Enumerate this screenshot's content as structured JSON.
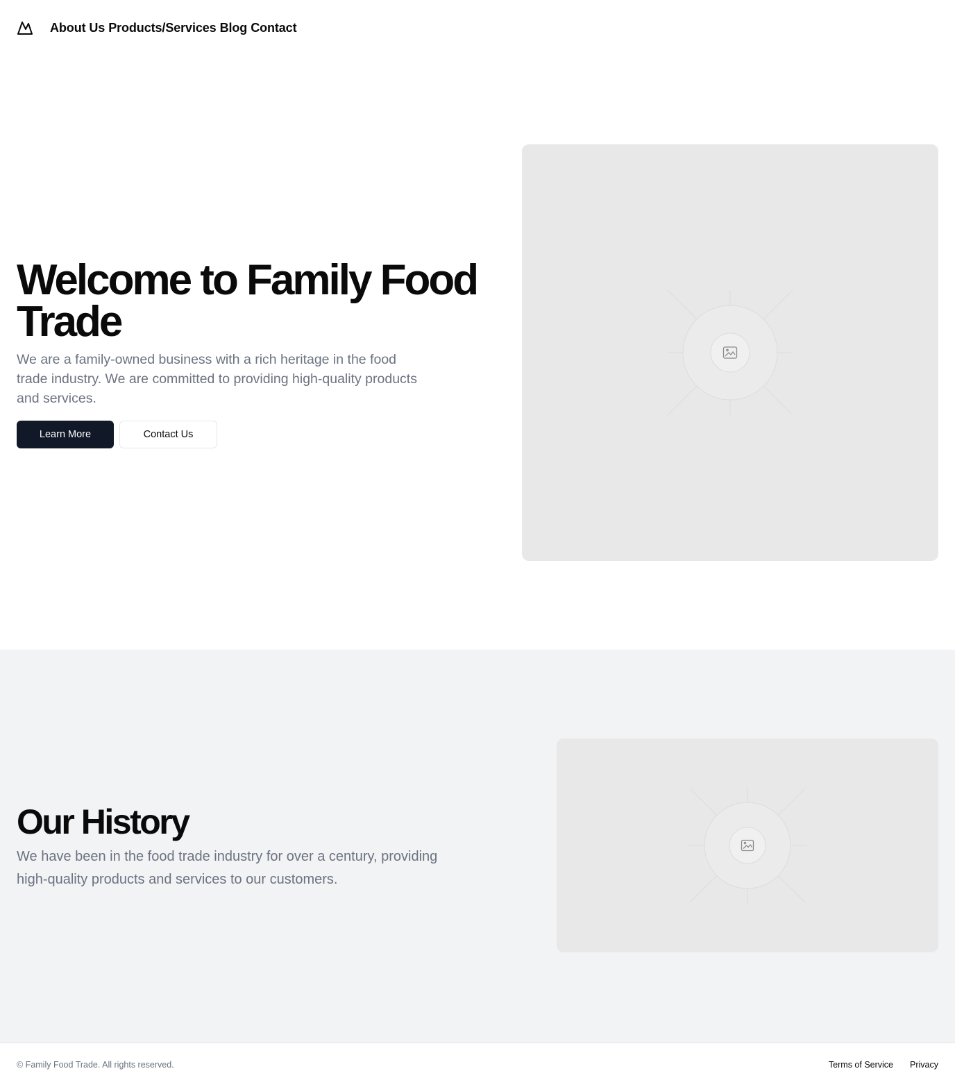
{
  "header": {
    "logo_icon": "mountain-logo-icon",
    "nav": [
      {
        "label": "About Us"
      },
      {
        "label": "Products/Services"
      },
      {
        "label": "Blog"
      },
      {
        "label": "Contact"
      }
    ]
  },
  "hero": {
    "title": "Welcome to Family Food Trade",
    "subtitle": "We are a family-owned business with a rich heritage in the food trade industry. We are committed to providing high-quality products and services.",
    "primary_button": "Learn More",
    "secondary_button": "Contact Us",
    "image_icon": "image-placeholder-icon"
  },
  "history": {
    "title": "Our History",
    "subtitle": "We have been in the food trade industry for over a century, providing high-quality products and services to our customers.",
    "image_icon": "image-placeholder-icon"
  },
  "footer": {
    "copyright": "© Family Food Trade. All rights reserved.",
    "links": [
      {
        "label": "Terms of Service"
      },
      {
        "label": "Privacy"
      }
    ]
  },
  "colors": {
    "primary_button_bg": "#111827",
    "muted_text": "#6b7280",
    "section_bg": "#f2f3f5",
    "placeholder_bg": "#e8e8e8"
  }
}
